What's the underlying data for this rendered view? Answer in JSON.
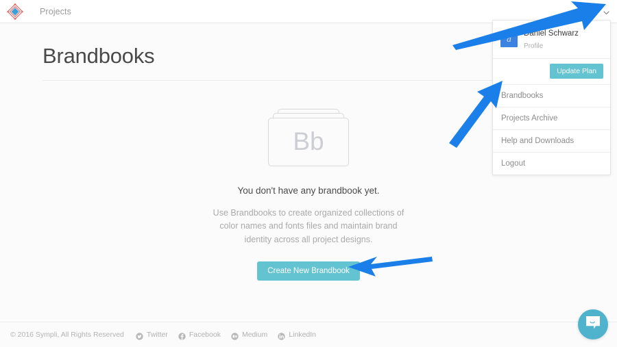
{
  "header": {
    "nav_label": "Projects",
    "logo_icon": "sympli-diamond-logo",
    "avatar_icon": "user-avatar-icon",
    "chevron_icon": "chevron-down-icon"
  },
  "main": {
    "page_title": "Brandbooks",
    "empty_state": {
      "illustration_letters": "Bb",
      "headline": "You don't have any brandbook yet.",
      "description": "Use Brandbooks to create organized collections of color names and fonts files and maintain brand identity across all project designs.",
      "cta_label": "Create New Brandbook"
    }
  },
  "dropdown": {
    "user_name": "Daniel Schwarz",
    "user_subtitle": "Profile",
    "avatar_initial": "d",
    "update_plan_label": "Update Plan",
    "items": [
      {
        "label": "Brandbooks"
      },
      {
        "label": "Projects Archive"
      },
      {
        "label": "Help and Downloads"
      },
      {
        "label": "Logout"
      }
    ]
  },
  "footer": {
    "copyright": "© 2016 Sympli, All Rights Reserved",
    "socials": [
      {
        "label": "Twitter",
        "icon": "twitter-icon"
      },
      {
        "label": "Facebook",
        "icon": "facebook-icon"
      },
      {
        "label": "Medium",
        "icon": "medium-icon"
      },
      {
        "label": "LinkedIn",
        "icon": "linkedin-icon"
      }
    ]
  },
  "chat_widget": {
    "icon": "chat-bubble-icon"
  },
  "annotations": {
    "arrow_color": "#1a7fe8",
    "arrows": [
      {
        "name": "arrow-to-avatar-menu",
        "points_to": "avatar-icon"
      },
      {
        "name": "arrow-to-brandbooks-item",
        "points_to": "dropdown-item-brandbooks"
      },
      {
        "name": "arrow-to-create-brandbook",
        "points_to": "create-new-brandbook-button"
      }
    ]
  },
  "colors": {
    "accent_teal": "#63c3d1",
    "arrow_blue": "#1a7fe8",
    "avatar_blue": "#3c82e0",
    "chat_blue": "#4fb3cd",
    "page_bg": "#fbfbfb"
  }
}
